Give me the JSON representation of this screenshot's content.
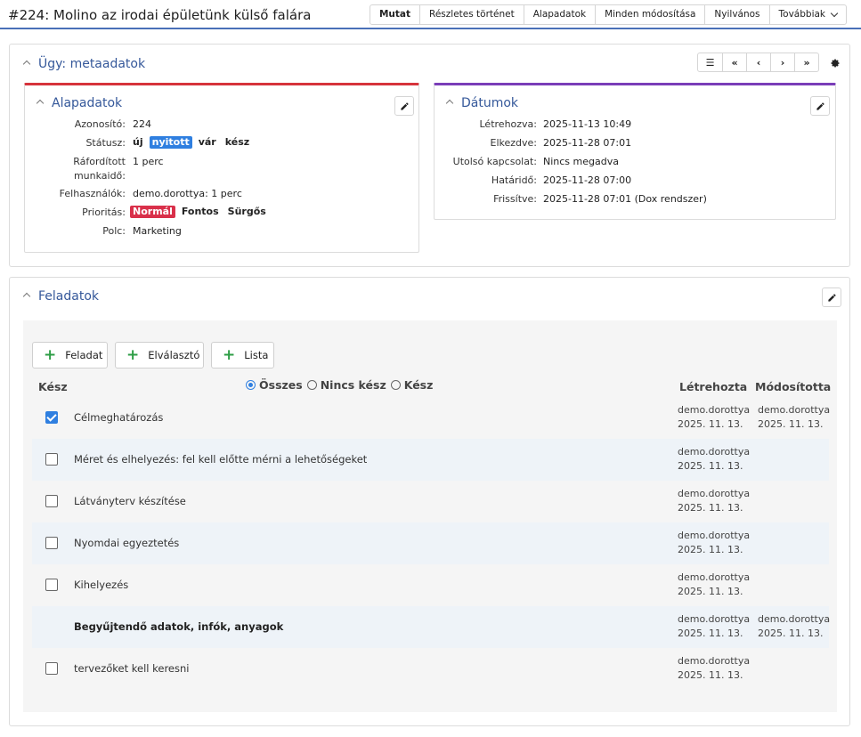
{
  "header": {
    "title": "#224: Molino az irodai épületünk külső falára",
    "tabs": [
      "Mutat",
      "Részletes történet",
      "Alapadatok",
      "Minden módosítása",
      "Nyilvános",
      "Továbbiak"
    ]
  },
  "meta_panel": {
    "title": "Ügy: metaadatok",
    "nav": [
      "list-icon",
      "first-icon",
      "prev-icon",
      "next-icon",
      "last-icon"
    ],
    "nav_glyphs": [
      "☰",
      "«",
      "‹",
      "›",
      "»"
    ]
  },
  "basic": {
    "title": "Alapadatok",
    "id_label": "Azonosító:",
    "id_value": "224",
    "status_label": "Státusz:",
    "status_options": [
      "új",
      "nyitott",
      "vár",
      "kész"
    ],
    "status_selected": "nyitott",
    "effort_label_1": "Ráfordított",
    "effort_label_2": "munkaidő:",
    "effort_value": "1 perc",
    "users_label": "Felhasználók:",
    "users_value": "demo.dorottya: 1 perc",
    "priority_label": "Prioritás:",
    "priority_options": [
      "Normál",
      "Fontos",
      "Sürgős"
    ],
    "priority_selected": "Normál",
    "shelf_label": "Polc:",
    "shelf_value": "Marketing"
  },
  "dates": {
    "title": "Dátumok",
    "created_label": "Létrehozva:",
    "created_value": "2025-11-13 10:49",
    "started_label": "Elkezdve:",
    "started_value": "2025-11-28 07:01",
    "last_contact_label": "Utolsó kapcsolat:",
    "last_contact_value": "Nincs megadva",
    "deadline_label": "Határidő:",
    "deadline_value": "2025-11-28 07:00",
    "updated_label": "Frissítve:",
    "updated_value": "2025-11-28 07:01 (Dox rendszer)"
  },
  "tasks": {
    "title": "Feladatok",
    "add_buttons": [
      "Feladat",
      "Elválasztó",
      "Lista"
    ],
    "col_done": "Kész",
    "col_created_by": "Létrehozta",
    "col_modified_by": "Módosította",
    "filter": [
      "Összes",
      "Nincs kész",
      "Kész"
    ],
    "filter_selected": "Összes",
    "rows": [
      {
        "label": "Célmeghatározás",
        "checked": true,
        "separator": false,
        "created_by": "demo.dorottya",
        "created_date": "2025. 11. 13.",
        "modified_by": "demo.dorottya",
        "modified_date": "2025. 11. 13."
      },
      {
        "label": "Méret és elhelyezés: fel kell előtte mérni a lehetőségeket",
        "checked": false,
        "separator": false,
        "created_by": "demo.dorottya",
        "created_date": "2025. 11. 13.",
        "modified_by": "",
        "modified_date": ""
      },
      {
        "label": "Látványterv készítése",
        "checked": false,
        "separator": false,
        "created_by": "demo.dorottya",
        "created_date": "2025. 11. 13.",
        "modified_by": "",
        "modified_date": ""
      },
      {
        "label": "Nyomdai egyeztetés",
        "checked": false,
        "separator": false,
        "created_by": "demo.dorottya",
        "created_date": "2025. 11. 13.",
        "modified_by": "",
        "modified_date": ""
      },
      {
        "label": "Kihelyezés",
        "checked": false,
        "separator": false,
        "created_by": "demo.dorottya",
        "created_date": "2025. 11. 13.",
        "modified_by": "",
        "modified_date": ""
      },
      {
        "label": "Begyűjtendő adatok, infók, anyagok",
        "checked": false,
        "separator": true,
        "created_by": "demo.dorottya",
        "created_date": "2025. 11. 13.",
        "modified_by": "demo.dorottya",
        "modified_date": "2025. 11. 13."
      },
      {
        "label": "tervezőket kell keresni",
        "checked": false,
        "separator": false,
        "created_by": "demo.dorottya",
        "created_date": "2025. 11. 13.",
        "modified_by": "",
        "modified_date": ""
      }
    ]
  },
  "colors": {
    "accent": "#35589a",
    "header_line": "#4a70b8",
    "basic_top": "#d6333b",
    "dates_top": "#7a3db8",
    "checkbox": "#2f7fe0",
    "plus": "#2e9e46"
  }
}
